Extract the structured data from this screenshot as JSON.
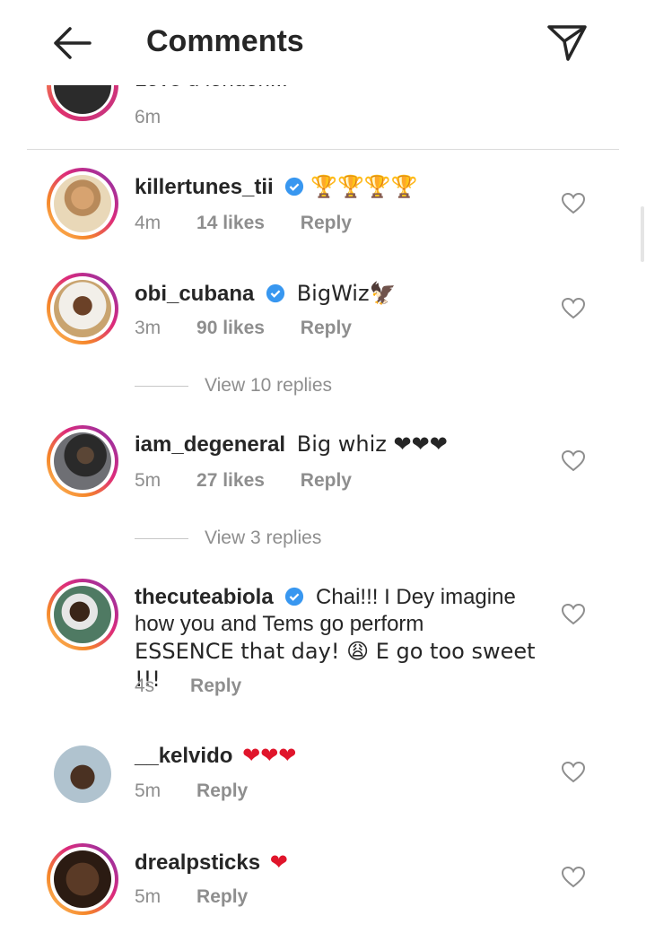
{
  "header": {
    "title": "Comments"
  },
  "prev_comment": {
    "text": "Love u london...",
    "time": "6m"
  },
  "comments": [
    {
      "username": "killertunes_tii",
      "text": "🏆🏆🏆🏆",
      "time": "4m",
      "likes": "14 likes",
      "reply": "Reply"
    },
    {
      "username": "obi_cubana",
      "text": "BigWiz🦅",
      "time": "3m",
      "likes": "90 likes",
      "reply": "Reply",
      "view_replies": "View 10 replies"
    },
    {
      "username": "iam_degeneral",
      "text": "Big whiz ❤❤❤",
      "time": "5m",
      "likes": "27 likes",
      "reply": "Reply",
      "view_replies": "View 3 replies"
    },
    {
      "username": "thecuteabiola",
      "text_line1": "Chai!!! I Dey imagine",
      "text_line2": "how you and Tems go perform",
      "text_line3": "ESSENCE that day! 😩 E go too sweet !!!",
      "time": "4s",
      "reply": "Reply"
    },
    {
      "username": "__kelvido",
      "text": "❤❤❤",
      "time": "5m",
      "reply": "Reply"
    },
    {
      "username": "drealpsticks",
      "text": "❤",
      "time": "5m",
      "reply": "Reply"
    }
  ],
  "colors": {
    "text": "#262626",
    "muted": "#8e8e8e",
    "verified": "#3897f0",
    "heart_red": "#e0152b"
  }
}
